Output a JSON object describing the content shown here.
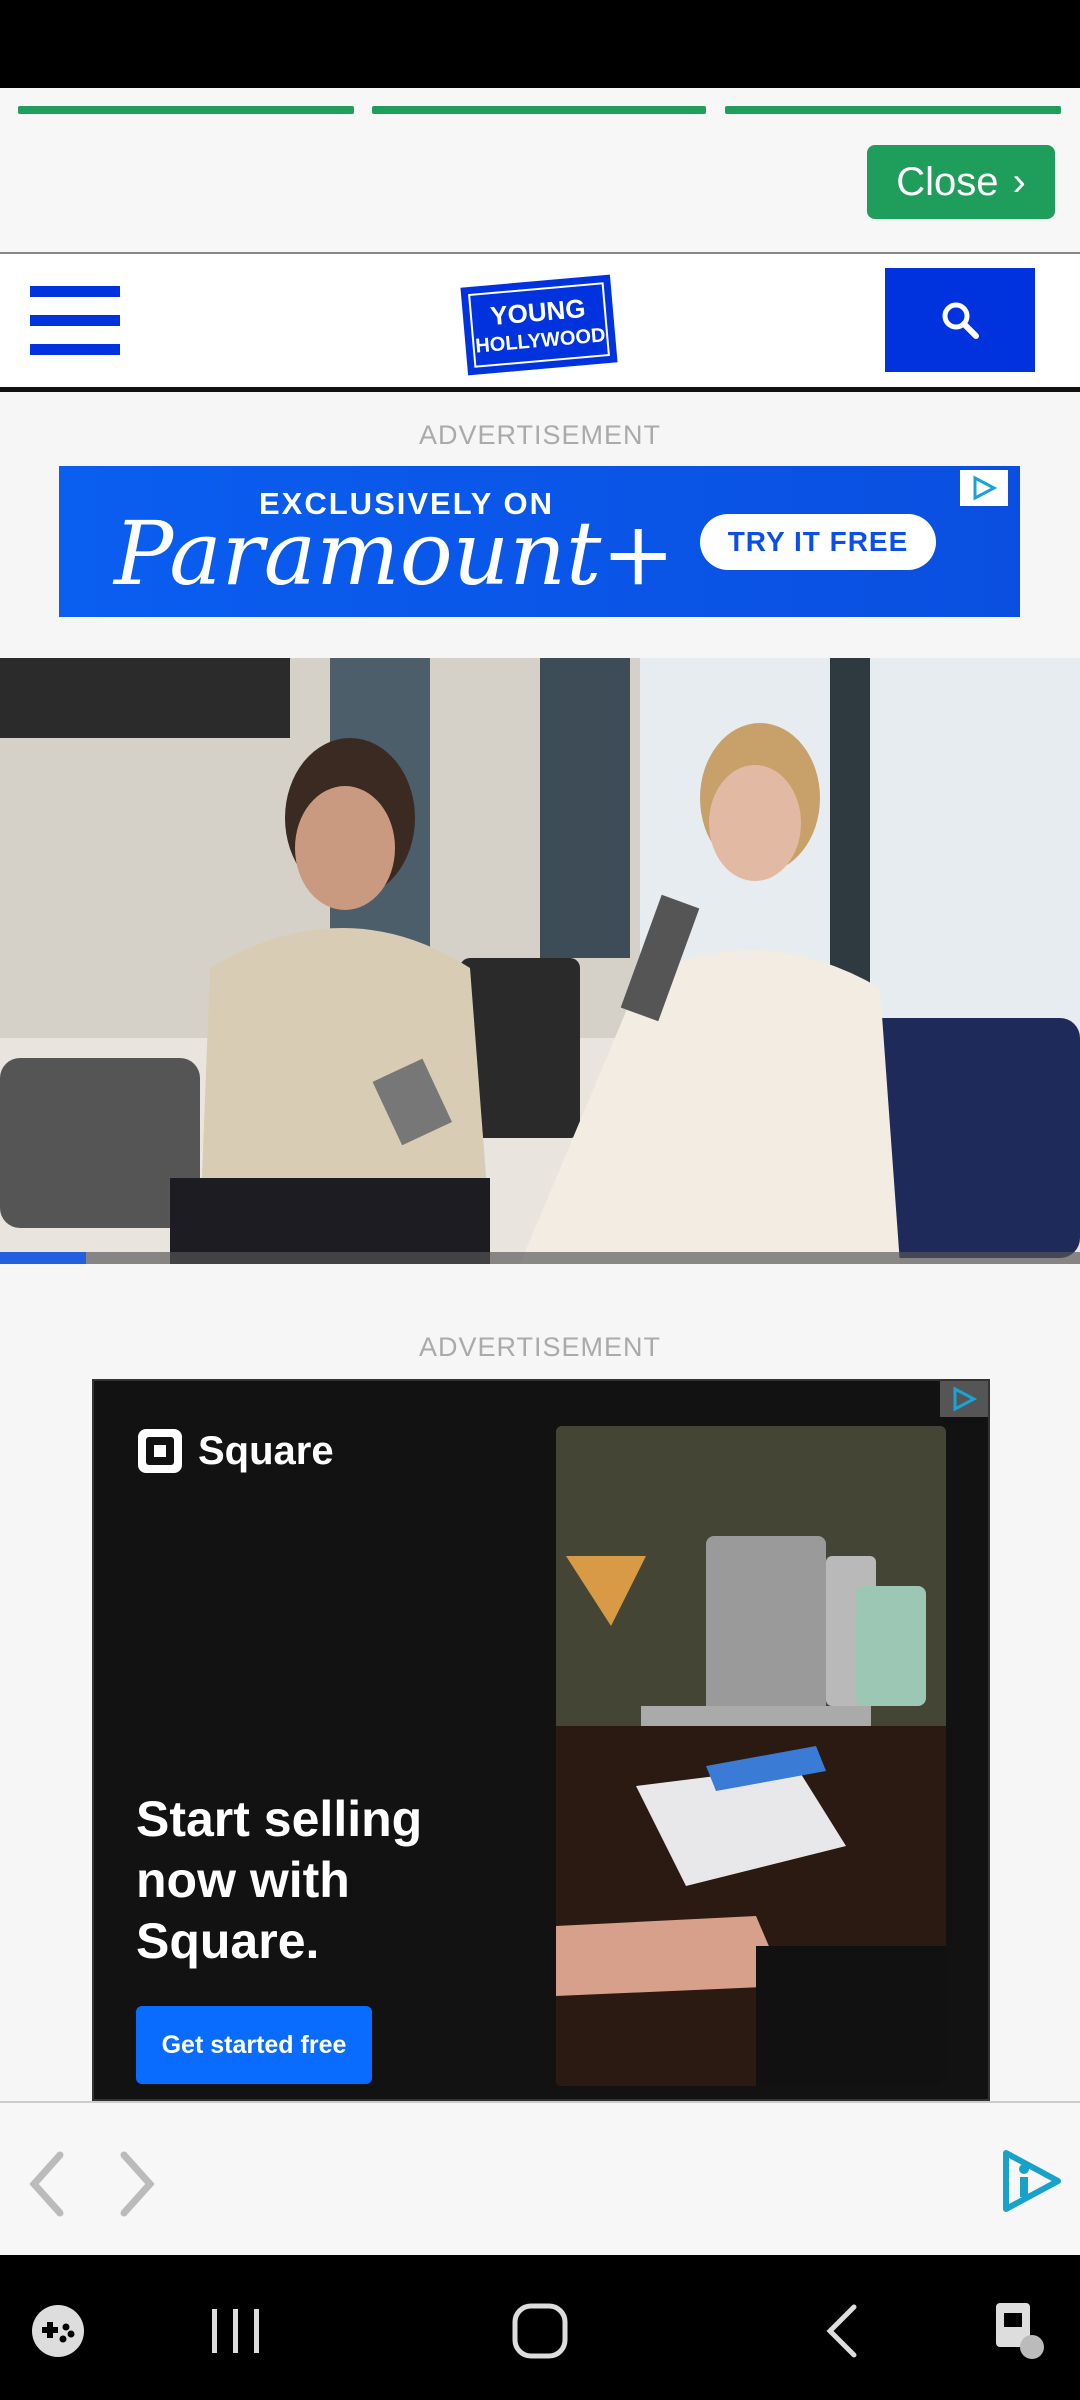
{
  "story": {
    "progress_segments": 3,
    "close_label": "Close"
  },
  "header": {
    "logo_line1": "YOUNG",
    "logo_line2": "HOLLYWOOD",
    "brand_color": "#0033dd"
  },
  "ads": {
    "label": "ADVERTISEMENT",
    "paramount": {
      "tagline": "EXCLUSIVELY ON",
      "brand": "Paramount+",
      "cta": "TRY IT FREE"
    },
    "square": {
      "brand": "Square",
      "headline": "Start selling now with Square.",
      "cta": "Get started free"
    }
  },
  "video": {
    "progress": 0.08
  },
  "icons": [
    "menu-icon",
    "search-icon",
    "adchoices-icon",
    "back-arrow-icon",
    "forward-arrow-icon",
    "app-logo-icon"
  ]
}
